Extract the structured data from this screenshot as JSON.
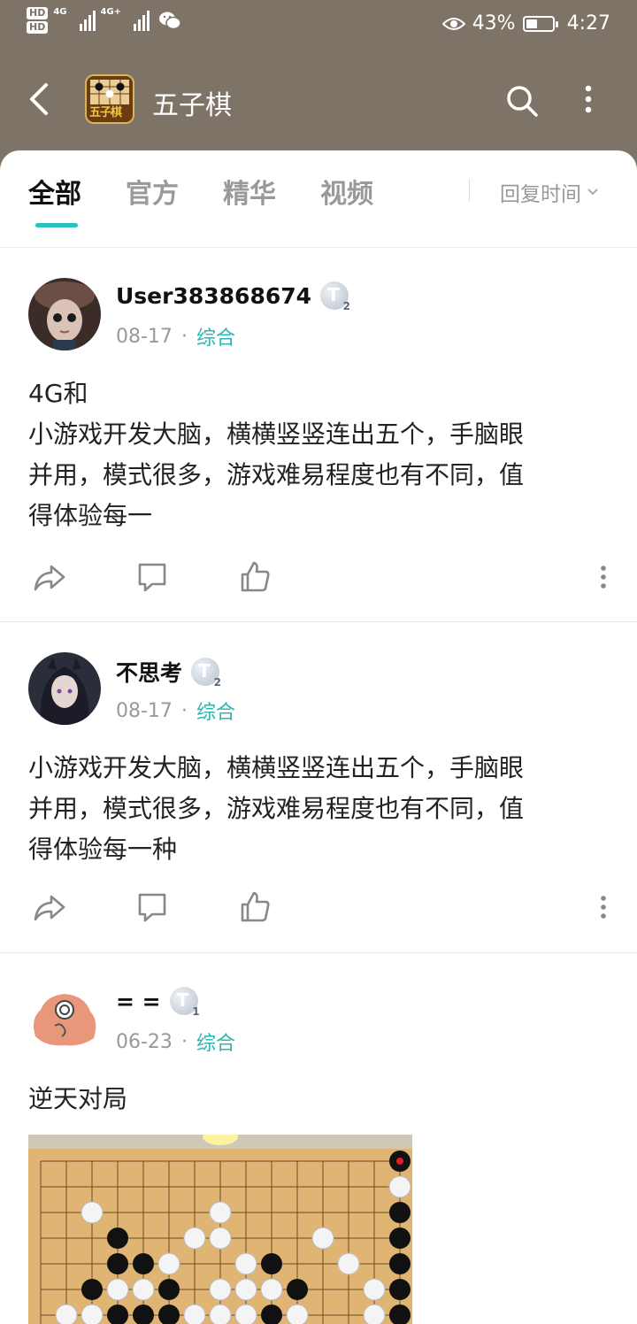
{
  "status_bar": {
    "hd1": "HD",
    "hd2": "HD",
    "net1": "4G",
    "net2": "4G+",
    "battery_percent_label": "43%",
    "battery_level": 0.43,
    "time": "4:27"
  },
  "app_bar": {
    "logo_text": "五子棋",
    "title": "五子棋"
  },
  "tabs": [
    {
      "label": "全部",
      "active": true
    },
    {
      "label": "官方",
      "active": false
    },
    {
      "label": "精华",
      "active": false
    },
    {
      "label": "视频",
      "active": false
    }
  ],
  "sort": {
    "label": "回复时间"
  },
  "posts": [
    {
      "username": "User383868674",
      "level": "2",
      "date": "08-17",
      "category": "综合",
      "text": "4G和\n小游戏开发大脑，横横竖竖连出五个，手脑眼\n并用，模式很多，游戏难易程度也有不同，值\n得体验每一"
    },
    {
      "username": "不思考",
      "level": "2",
      "date": "08-17",
      "category": "综合",
      "text": "小游戏开发大脑，横横竖竖连出五个，手脑眼\n并用，模式很多，游戏难易程度也有不同，值\n得体验每一种"
    },
    {
      "username": "= =",
      "level": "1",
      "date": "06-23",
      "category": "综合",
      "text": "逆天对局"
    }
  ],
  "colors": {
    "accent": "#2ac1bc",
    "header_bg": "#7d7367"
  }
}
